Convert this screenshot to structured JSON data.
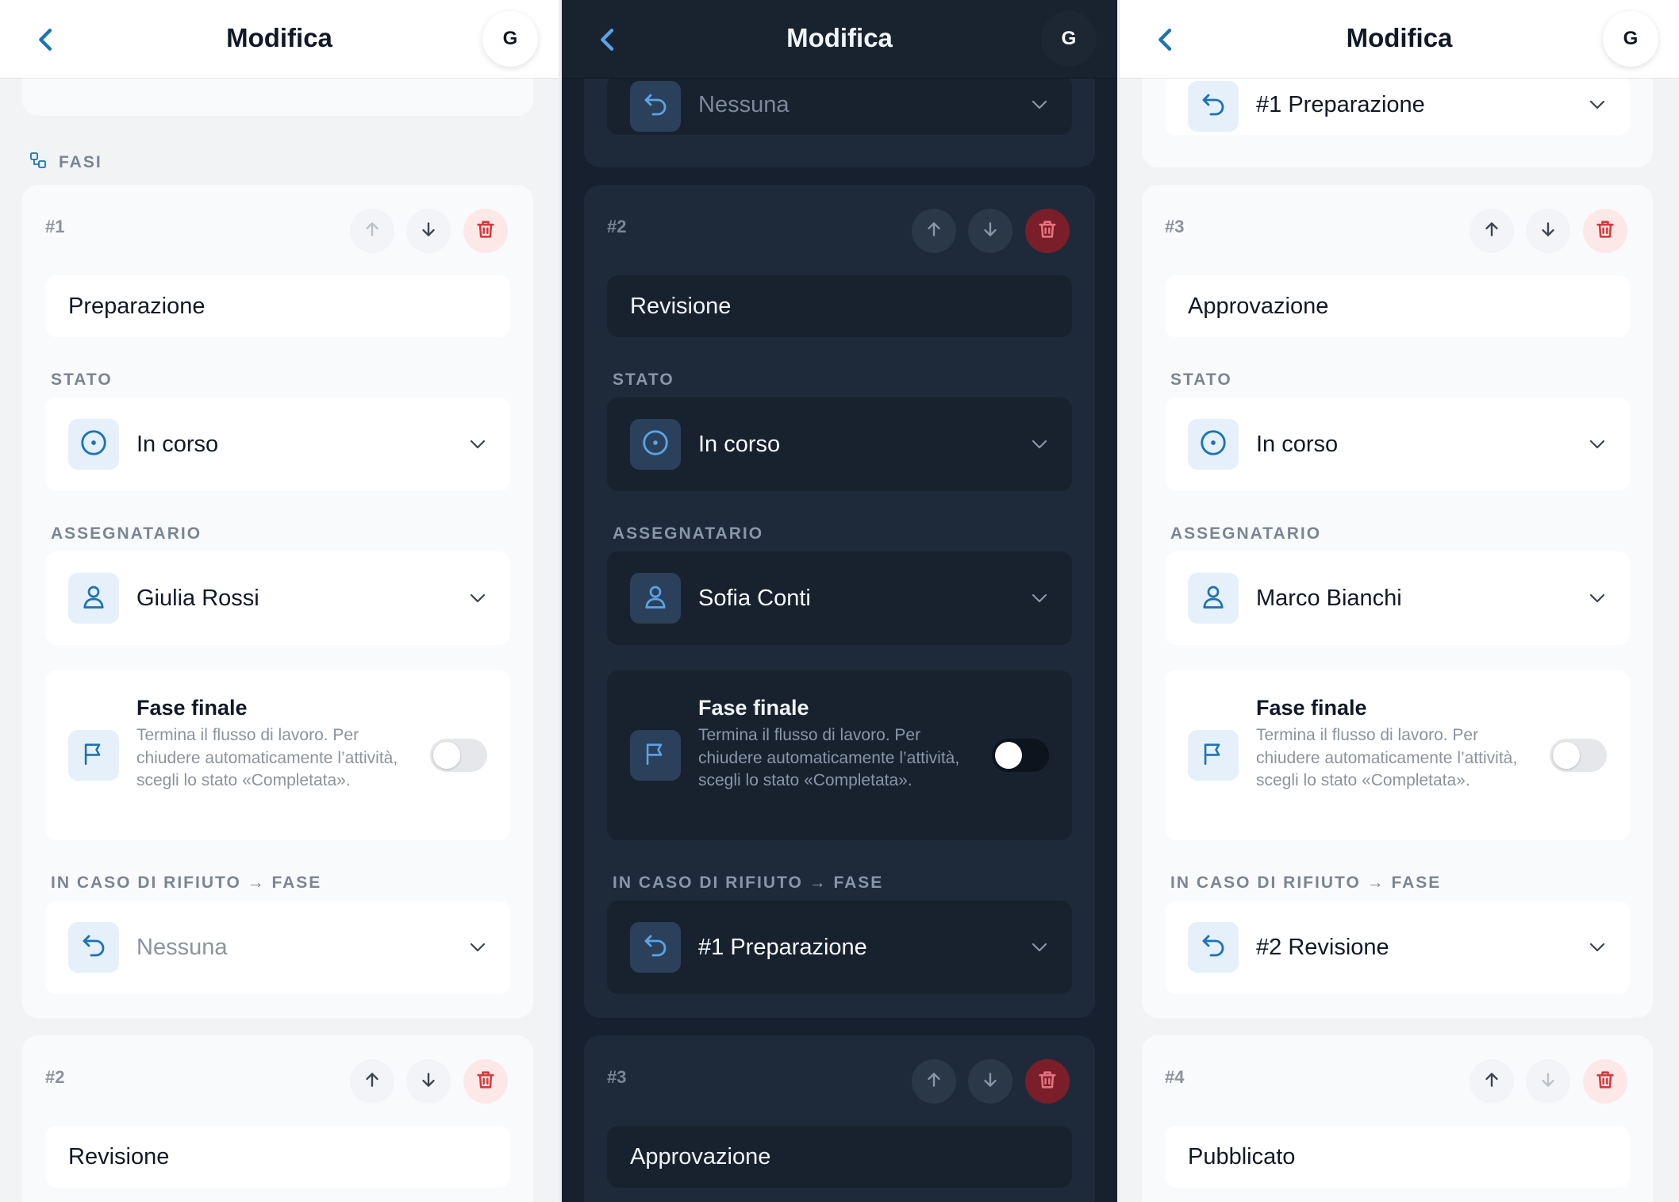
{
  "accent_color": "#1a73b8",
  "danger_color": "#d63a3a",
  "header": {
    "title": "Modifica",
    "avatar": "G",
    "back_icon": "chevron-left-icon"
  },
  "labels": {
    "section": "FASI",
    "stato": "STATO",
    "assegnatario": "ASSEGNATARIO",
    "final_title": "Fase finale",
    "final_desc": "Termina il flusso di lavoro. Per chiudere automaticamente l’attività, scegli lo stato «Completata».",
    "reject": "IN CASO DI RIFIUTO → FASE"
  },
  "icons": {
    "section": "workflow-icon",
    "up": "arrow-up-icon",
    "down": "arrow-down-icon",
    "delete": "trash-icon",
    "status": "target-circle-icon",
    "assignee": "user-icon",
    "final": "flag-icon",
    "reject": "undo-arrow-icon",
    "chevron": "chevron-down-icon"
  },
  "screens": [
    {
      "theme": "light",
      "top_reject_value": "",
      "steps": [
        {
          "number": "#1",
          "name": "Preparazione",
          "status": "In corso",
          "assignee": "Giulia Rossi",
          "final_on": false,
          "reject_value": "Nessuna",
          "reject_empty": true,
          "up_disabled": true,
          "down_disabled": false
        },
        {
          "number": "#2",
          "name": "Revisione",
          "up_disabled": false,
          "down_disabled": false
        }
      ]
    },
    {
      "theme": "dark",
      "top_reject_value": "Nessuna",
      "steps": [
        {
          "number": "#2",
          "name": "Revisione",
          "status": "In corso",
          "assignee": "Sofia Conti",
          "final_on": true,
          "reject_value": "#1 Preparazione",
          "reject_empty": false,
          "up_disabled": false,
          "down_disabled": false
        },
        {
          "number": "#3",
          "name": "Approvazione",
          "up_disabled": false,
          "down_disabled": false
        }
      ]
    },
    {
      "theme": "light",
      "top_reject_value": "#1 Preparazione",
      "steps": [
        {
          "number": "#3",
          "name": "Approvazione",
          "status": "In corso",
          "assignee": "Marco Bianchi",
          "final_on": false,
          "reject_value": "#2 Revisione",
          "reject_empty": false,
          "up_disabled": false,
          "down_disabled": false
        },
        {
          "number": "#4",
          "name": "Pubblicato",
          "up_disabled": false,
          "down_disabled": true
        }
      ]
    }
  ]
}
